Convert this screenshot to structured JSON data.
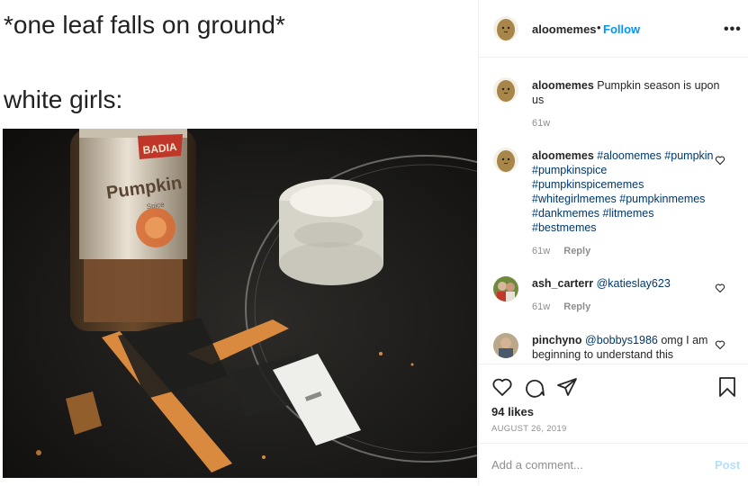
{
  "media": {
    "caption_top": "*one leaf falls on ground*",
    "caption_bottom": "white girls:",
    "bottle_brand": "BADIA",
    "bottle_label": "Pumpkin",
    "bottle_sub": "Spice"
  },
  "header": {
    "username": "aloomemes",
    "dot": "•",
    "follow_label": "Follow",
    "more_label": "•••"
  },
  "comments": [
    {
      "username": "aloomemes",
      "text": "Pumpkin season is upon us",
      "time": "61w"
    },
    {
      "username": "aloomemes",
      "hashtags": "#aloomemes #pumpkin #pumpkinspice #pumpkinspicememes #whitegirlmemes #pumpkinmemes #dankmemes #litmemes #bestmemes",
      "time": "61w",
      "reply_label": "Reply"
    },
    {
      "username": "ash_carterr",
      "mention": "@katieslay623",
      "time": "61w",
      "reply_label": "Reply"
    },
    {
      "username": "pinchyno",
      "mention": "@bobbys1986",
      "text": "omg I am beginning to understand this"
    }
  ],
  "actions": {
    "likes": "94 likes",
    "date": "AUGUST 26, 2019",
    "comment_placeholder": "Add a comment...",
    "post_label": "Post"
  },
  "colors": {
    "link_blue": "#0095f6",
    "tag_blue": "#00376b",
    "muted": "#8e8e8e",
    "post_disabled": "#b2dffc"
  }
}
